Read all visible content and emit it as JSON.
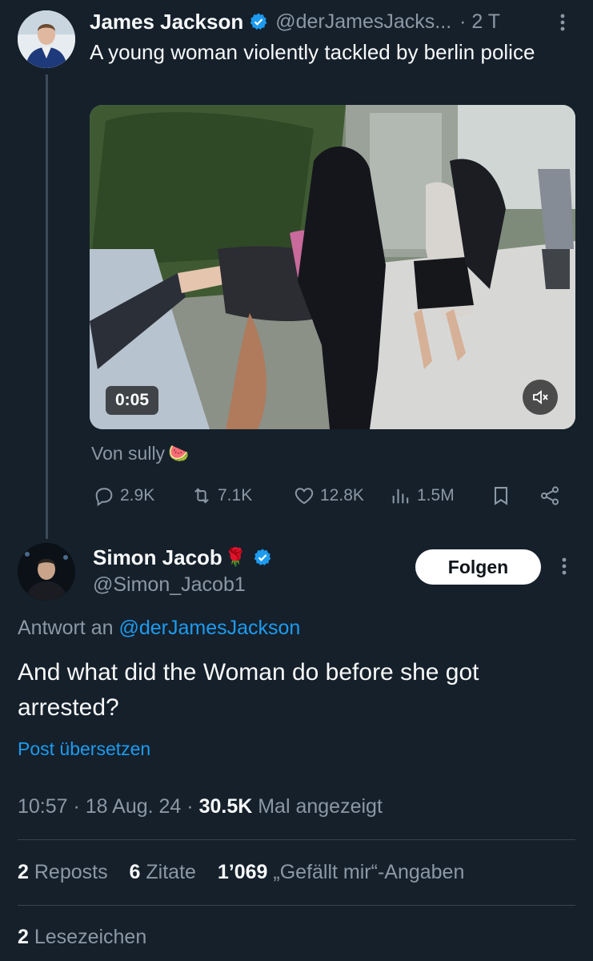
{
  "tweet1": {
    "name": "James Jackson",
    "handle": "@derJamesJacks...",
    "time": "· 2 T",
    "text": "A young woman violently tackled by berlin police",
    "video_duration": "0:05",
    "credit_prefix": "Von sully",
    "credit_emoji": "🍉",
    "replies": "2.9K",
    "reposts": "7.1K",
    "likes": "12.8K",
    "views": "1.5M"
  },
  "tweet2": {
    "name": "Simon Jacob",
    "name_emoji": "🌹",
    "handle": "@Simon_Jacob1",
    "follow_label": "Folgen",
    "reply_to_prefix": "Antwort an",
    "reply_to_handle": "@derJamesJackson",
    "text": "And what did the Woman do before she got arrested?",
    "translate": "Post übersetzen",
    "timestamp": "10:57 · 18 Aug. 24 ·",
    "views_count": "30.5K",
    "views_label": "Mal angezeigt",
    "stats": {
      "reposts_count": "2",
      "reposts_label": "Reposts",
      "quotes_count": "6",
      "quotes_label": "Zitate",
      "likes_count": "1’069",
      "likes_label": "„Gefällt mir“-Angaben",
      "bookmarks_count": "2",
      "bookmarks_label": "Lesezeichen"
    }
  },
  "colors": {
    "background": "#15202b",
    "text": "#f7f9f9",
    "muted": "#8b98a5",
    "accent": "#1d9bf0"
  },
  "icons": [
    "verified-badge-icon",
    "more-icon",
    "reply-icon",
    "repost-icon",
    "like-icon",
    "views-icon",
    "bookmark-icon",
    "share-icon",
    "mute-icon"
  ]
}
